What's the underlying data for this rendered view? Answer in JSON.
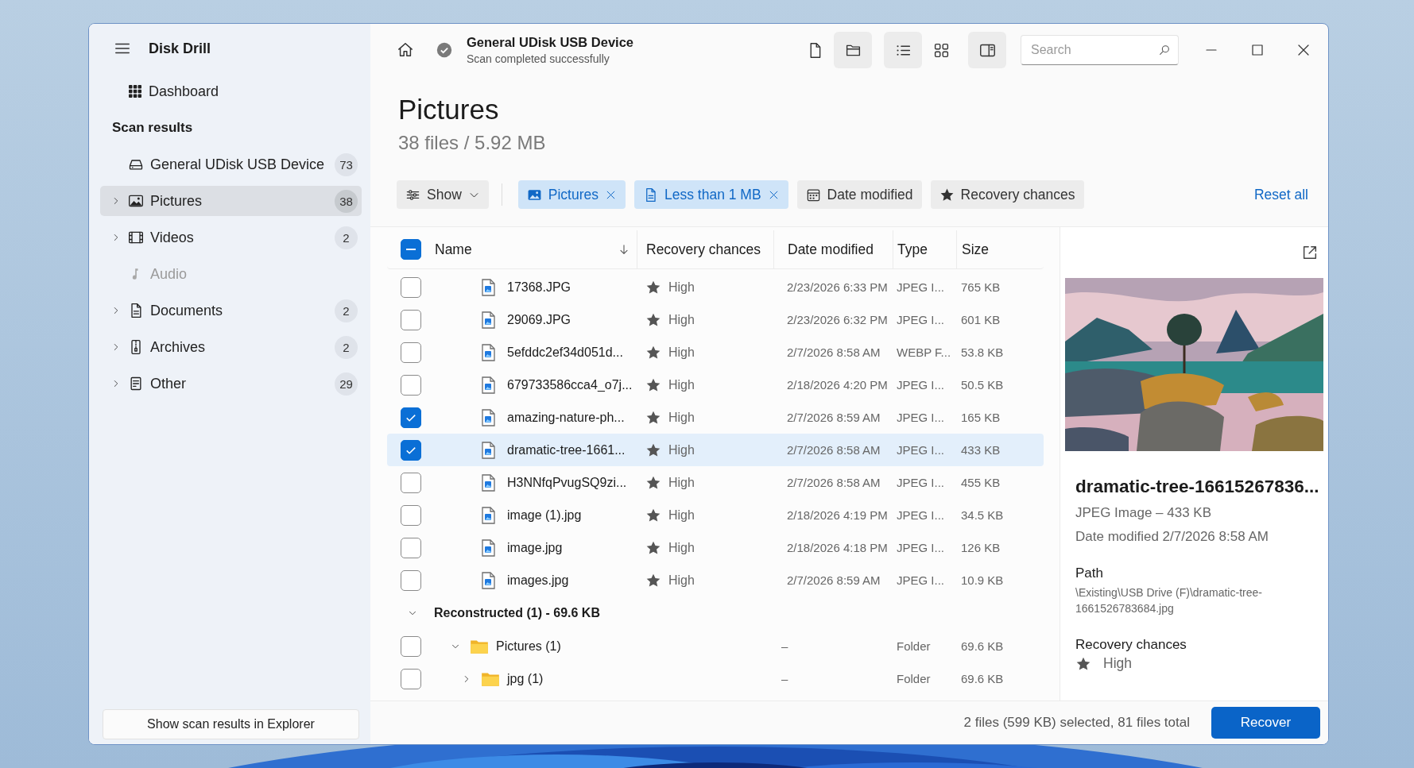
{
  "app": {
    "title": "Disk Drill"
  },
  "sidebar": {
    "dashboard": "Dashboard",
    "section": "Scan results",
    "device": {
      "label": "General UDisk USB Device",
      "count": "73"
    },
    "categories": [
      {
        "kind": "images",
        "label": "Pictures",
        "count": "38",
        "expandable": true,
        "selected": true,
        "disabled": false
      },
      {
        "kind": "video",
        "label": "Videos",
        "count": "2",
        "expandable": true,
        "selected": false,
        "disabled": false
      },
      {
        "kind": "audio",
        "label": "Audio",
        "expandable": false,
        "selected": false,
        "disabled": true
      },
      {
        "kind": "document",
        "label": "Documents",
        "count": "2",
        "expandable": true,
        "selected": false,
        "disabled": false
      },
      {
        "kind": "archive",
        "label": "Archives",
        "count": "2",
        "expandable": true,
        "selected": false,
        "disabled": false
      },
      {
        "kind": "other",
        "label": "Other",
        "count": "29",
        "expandable": true,
        "selected": false,
        "disabled": false
      }
    ],
    "explorer_button": "Show scan results in Explorer"
  },
  "header": {
    "device": "General UDisk USB Device",
    "status": "Scan completed successfully",
    "toolbar": [
      {
        "kind": "file",
        "selected": false
      },
      {
        "kind": "folder",
        "selected": true
      },
      {
        "kind": "list",
        "selected": true
      },
      {
        "kind": "grid",
        "selected": false
      },
      {
        "kind": "pane",
        "selected": true
      }
    ],
    "search": {
      "placeholder": "Search"
    }
  },
  "page": {
    "title": "Pictures",
    "subtitle": "38 files / 5.92 MB"
  },
  "filters": [
    {
      "kind": "menu",
      "label": "Show",
      "active": false
    },
    {
      "kind": "type",
      "label": "Pictures",
      "active": true
    },
    {
      "kind": "size",
      "label": "Less than 1 MB",
      "active": true
    },
    {
      "kind": "date",
      "label": "Date modified",
      "active": false
    },
    {
      "kind": "chance",
      "label": "Recovery chances",
      "active": false
    }
  ],
  "reset": "Reset all",
  "table": {
    "select_all": {
      "indeterminate": true
    },
    "columns": [
      "Name",
      "Recovery chances",
      "Date modified",
      "Type",
      "Size"
    ],
    "rows": [
      {
        "name": "17368.JPG",
        "chance": "High",
        "date": "2/23/2026 6:33 PM",
        "type": "JPEG I...",
        "size": "765 KB",
        "checked": false,
        "selected": false
      },
      {
        "name": "29069.JPG",
        "chance": "High",
        "date": "2/23/2026 6:32 PM",
        "type": "JPEG I...",
        "size": "601 KB",
        "checked": false,
        "selected": false
      },
      {
        "name": "5efddc2ef34d051d...",
        "chance": "High",
        "date": "2/7/2026 8:58 AM",
        "type": "WEBP F...",
        "size": "53.8 KB",
        "checked": false,
        "selected": false
      },
      {
        "name": "679733586cca4_o7j...",
        "chance": "High",
        "date": "2/18/2026 4:20 PM",
        "type": "JPEG I...",
        "size": "50.5 KB",
        "checked": false,
        "selected": false
      },
      {
        "name": "amazing-nature-ph...",
        "chance": "High",
        "date": "2/7/2026 8:59 AM",
        "type": "JPEG I...",
        "size": "165 KB",
        "checked": true,
        "selected": false
      },
      {
        "name": "dramatic-tree-1661...",
        "chance": "High",
        "date": "2/7/2026 8:58 AM",
        "type": "JPEG I...",
        "size": "433 KB",
        "checked": true,
        "selected": true
      },
      {
        "name": "H3NNfqPvugSQ9zi...",
        "chance": "High",
        "date": "2/7/2026 8:58 AM",
        "type": "JPEG I...",
        "size": "455 KB",
        "checked": false,
        "selected": false
      },
      {
        "name": "image (1).jpg",
        "chance": "High",
        "date": "2/18/2026 4:19 PM",
        "type": "JPEG I...",
        "size": "34.5 KB",
        "checked": false,
        "selected": false
      },
      {
        "name": "image.jpg",
        "chance": "High",
        "date": "2/18/2026 4:18 PM",
        "type": "JPEG I...",
        "size": "126 KB",
        "checked": false,
        "selected": false
      },
      {
        "name": "images.jpg",
        "chance": "High",
        "date": "2/7/2026 8:59 AM",
        "type": "JPEG I...",
        "size": "10.9 KB",
        "checked": false,
        "selected": false
      }
    ],
    "group": {
      "label": "Reconstructed (1) - 69.6 KB",
      "expanded": true,
      "folders": [
        {
          "name": "Pictures (1)",
          "date": "–",
          "type": "Folder",
          "size": "69.6 KB",
          "checked": false,
          "expanded": true,
          "children": [
            {
              "name": "jpg (1)",
              "date": "–",
              "type": "Folder",
              "size": "69.6 KB",
              "checked": false,
              "expanded": false
            }
          ]
        }
      ]
    }
  },
  "preview": {
    "kind": "picture",
    "name": "dramatic-tree-16615267836...",
    "meta": "JPEG Image – 433 KB",
    "date": "Date modified 2/7/2026 8:58 AM",
    "path_label": "Path",
    "path": "\\Existing\\USB Drive (F)\\dramatic-tree-1661526783684.jpg",
    "chances_label": "Recovery chances",
    "chances": "High"
  },
  "footer": {
    "summary": "2 files (599 KB) selected, 81 files total",
    "recover": "Recover"
  }
}
